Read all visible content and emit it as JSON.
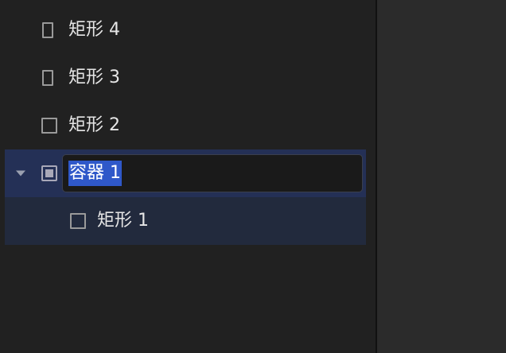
{
  "layers": {
    "items": [
      {
        "label": "矩形 4",
        "type": "rectangle"
      },
      {
        "label": "矩形 3",
        "type": "rectangle"
      },
      {
        "label": "矩形 2",
        "type": "rectangle"
      },
      {
        "label": "容器 1",
        "type": "container",
        "expanded": true,
        "selected": true,
        "editing": true
      },
      {
        "label": "矩形 1",
        "type": "rectangle",
        "parent": "容器 1"
      }
    ]
  },
  "colors": {
    "panel_bg": "#212121",
    "canvas_bg": "#2b2b2b",
    "selection_bg": "#243056",
    "child_highlight_bg": "#222a3d",
    "text_selection": "#2f58c9",
    "label_text": "#e6e6e6"
  },
  "icons": {
    "rectangle": "rectangle-icon",
    "container": "container-icon",
    "disclosure": "disclosure-triangle-down-icon"
  }
}
